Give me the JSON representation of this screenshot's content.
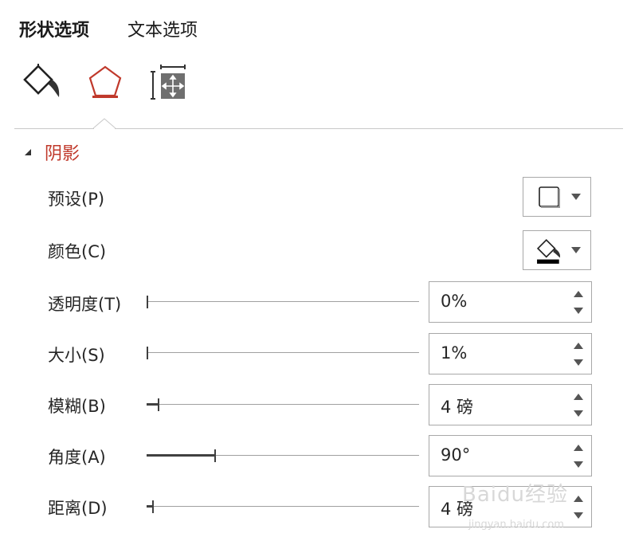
{
  "tabs": [
    {
      "label": "形状选项",
      "active": true
    },
    {
      "label": "文本选项",
      "active": false
    }
  ],
  "icon_tabs": [
    {
      "icon": "fill-line-icon",
      "active": false
    },
    {
      "icon": "effects-pentagon-icon",
      "active": true
    },
    {
      "icon": "size-properties-icon",
      "active": false
    }
  ],
  "section": {
    "title": "阴影",
    "expanded": true
  },
  "rows": {
    "preset": {
      "label": "预设(P)"
    },
    "color": {
      "label": "颜色(C)"
    },
    "transparency": {
      "label": "透明度(T)",
      "value": "0%",
      "slider_fraction": 0.0
    },
    "size": {
      "label": "大小(S)",
      "value": "1%",
      "slider_fraction": 0.0
    },
    "blur": {
      "label": "模糊(B)",
      "value": "4 磅",
      "slider_fraction": 0.04
    },
    "angle": {
      "label": "角度(A)",
      "value": "90°",
      "slider_fraction": 0.25
    },
    "distance": {
      "label": "距离(D)",
      "value": "4 磅",
      "slider_fraction": 0.02
    }
  },
  "watermark": {
    "text": "Baidu经验",
    "sub": "jingyan.baidu.com"
  },
  "colors": {
    "accent": "#c0392b",
    "border": "#a8a8a8"
  }
}
